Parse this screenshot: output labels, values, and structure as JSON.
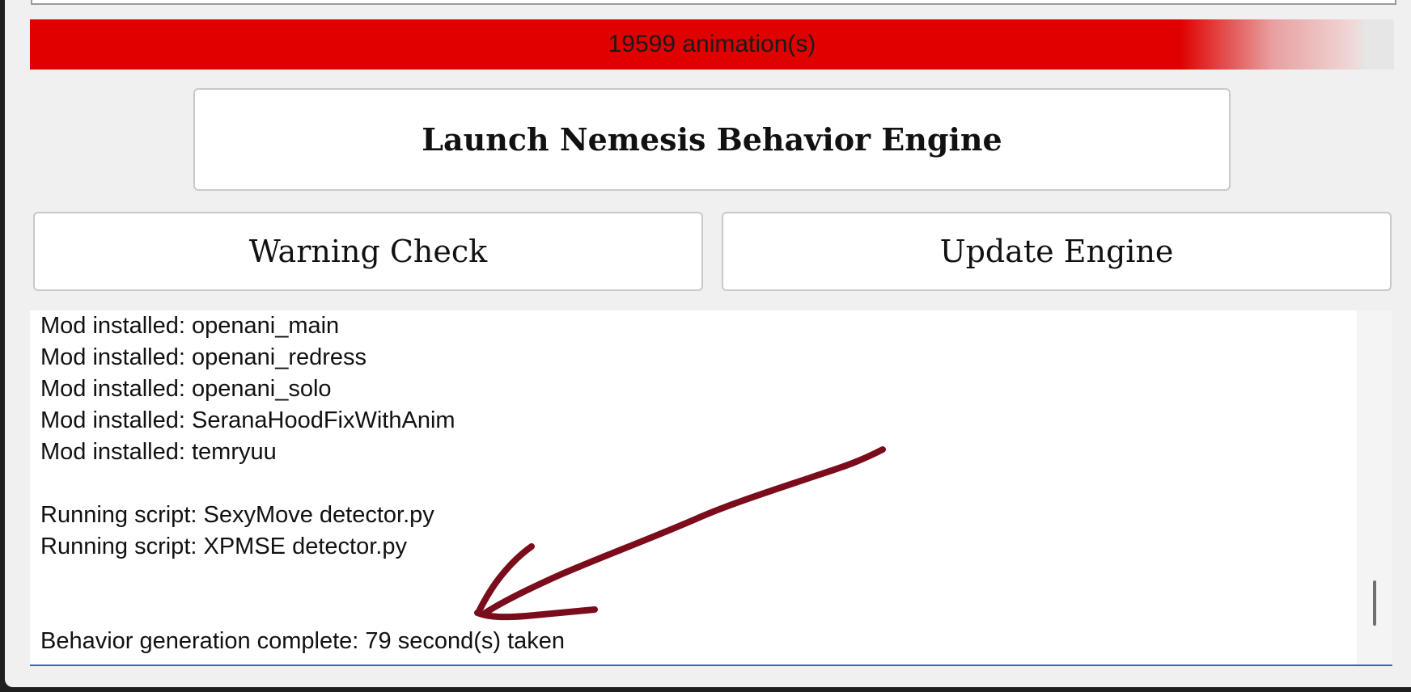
{
  "progress": {
    "label": "19599 animation(s)",
    "fill_fraction": 0.98,
    "color": "#e00000"
  },
  "buttons": {
    "launch": "Launch Nemesis Behavior Engine",
    "warning": "Warning Check",
    "update": "Update Engine"
  },
  "log": {
    "lines": [
      "Mod installed: openani_main",
      "Mod installed: openani_redress",
      "Mod installed: openani_solo",
      "Mod installed: SeranaHoodFixWithAnim",
      "Mod installed: temryuu",
      "",
      "Running script: SexyMove detector.py",
      "Running script: XPMSE detector.py",
      "",
      "",
      "Behavior generation complete: 79 second(s) taken"
    ]
  },
  "annotation": {
    "color": "#7a0c1c",
    "icon": "hand-drawn-arrow"
  }
}
